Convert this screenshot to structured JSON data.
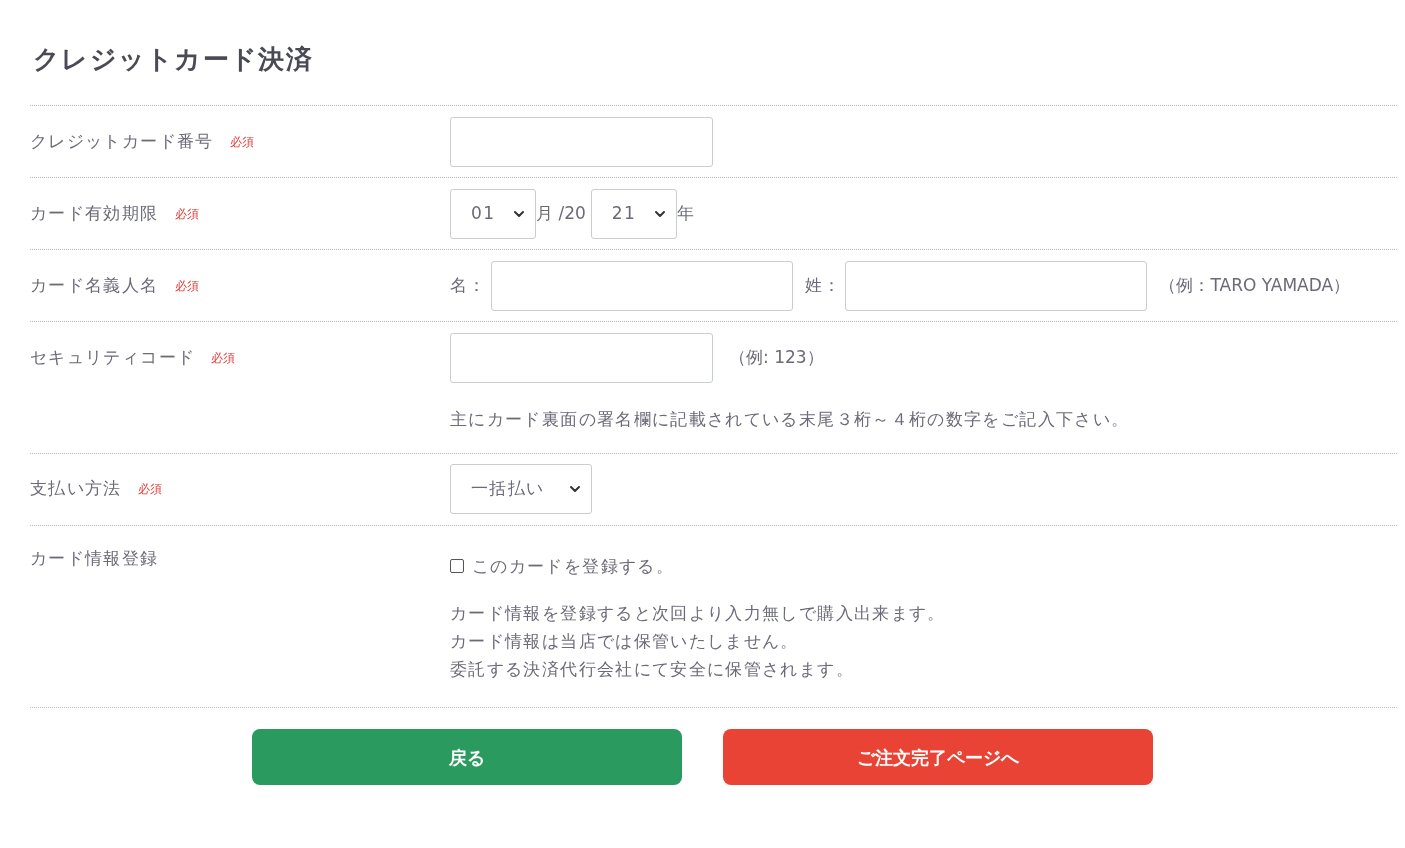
{
  "title": "クレジットカード決済",
  "rows": [
    {
      "kind": "input",
      "label": "クレジットカード番号",
      "badge": "必須"
    },
    {
      "kind": "expiry",
      "label": "カード有効期限",
      "badge": "必須",
      "month": "01",
      "separator": "月 /20",
      "year": "21",
      "suffix": "年"
    },
    {
      "kind": "name",
      "label": "カード名義人名",
      "badge": "必須",
      "first_label": "名：",
      "last_label": "姓：",
      "example": "（例：TARO YAMADA）"
    },
    {
      "kind": "security",
      "label": "セキュリティコード",
      "badge": "必須",
      "example": "（例: 123）",
      "note": "主にカード裏面の署名欄に記載されている末尾３桁～４桁の数字をご記入下さい。"
    },
    {
      "kind": "select",
      "label": "支払い方法",
      "badge": "必須",
      "value": "一括払い"
    },
    {
      "kind": "checkbox",
      "label": "カード情報登録",
      "checked": false,
      "option": "このカードを登録する。",
      "notes": [
        "カード情報を登録すると次回より入力無しで購入出来ます。",
        "カード情報は当店では保管いたしません。",
        "委託する決済代行会社にて安全に保管されます。"
      ]
    }
  ],
  "buttons": [
    {
      "kind": "back",
      "label": "戻る"
    },
    {
      "kind": "submit",
      "label": "ご注文完了ページへ"
    }
  ]
}
